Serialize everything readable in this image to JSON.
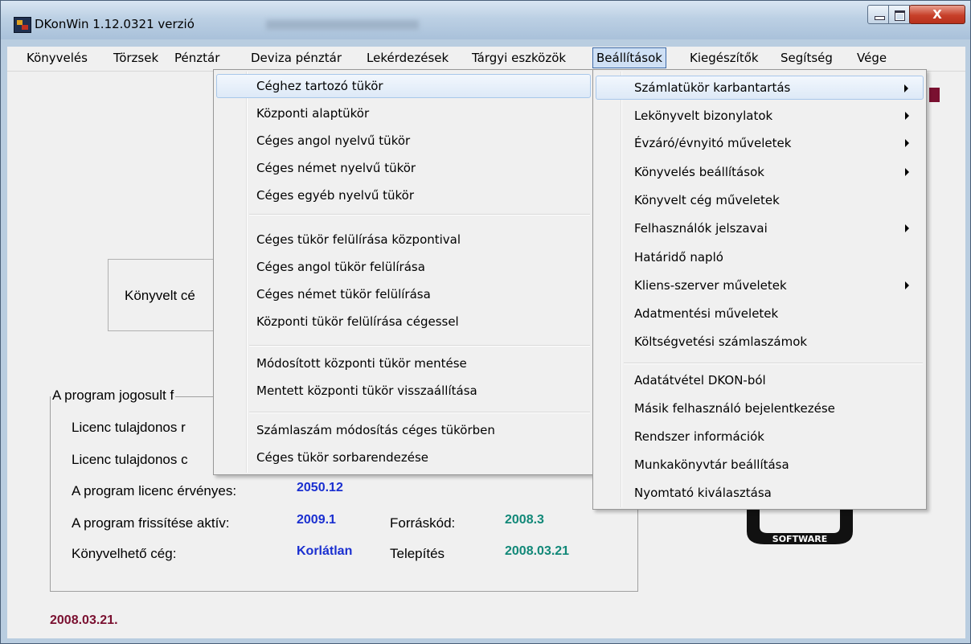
{
  "window": {
    "title": "DKonWin 1.12.0321 verzió",
    "close_glyph": "X"
  },
  "menubar": {
    "items": [
      "Könyvelés",
      "Törzsek",
      "Pénztár",
      "Deviza pénztár",
      "Lekérdezések",
      "Tárgyi eszközök",
      "Beállítások",
      "Kiegészítők",
      "Segítség",
      "Vége"
    ],
    "active": "Beállítások"
  },
  "settings_menu": {
    "items": [
      {
        "label": "Számlatükör karbantartás",
        "submenu": true,
        "highlighted": true
      },
      {
        "label": "Lekönyvelt bizonylatok",
        "submenu": true
      },
      {
        "label": "Évzáró/évnyitó műveletek",
        "submenu": true
      },
      {
        "label": "Könyvelés beállítások",
        "submenu": true
      },
      {
        "label": "Könyvelt cég műveletek",
        "submenu": false
      },
      {
        "label": "Felhasználók jelszavai",
        "submenu": true
      },
      {
        "label": "Határidő napló",
        "submenu": false
      },
      {
        "label": "Kliens-szerver műveletek",
        "submenu": true
      },
      {
        "label": "Adatmentési műveletek",
        "submenu": false
      },
      {
        "label": "Költségvetési számlaszámok",
        "submenu": false
      },
      {
        "label": "Adatátvétel DKON-ból",
        "submenu": false
      },
      {
        "label": "Másik felhasználó bejelentkezése",
        "submenu": false
      },
      {
        "label": "Rendszer információk",
        "submenu": false
      },
      {
        "label": "Munkakönyvtár beállítása",
        "submenu": false
      },
      {
        "label": "Nyomtató kiválasztása",
        "submenu": false
      }
    ]
  },
  "chart_submenu": {
    "items": [
      {
        "label": "Céghez tartozó tükör",
        "highlighted": true
      },
      {
        "label": "Központi alaptükör"
      },
      {
        "label": "Céges angol nyelvű tükör"
      },
      {
        "label": "Céges német nyelvű tükör"
      },
      {
        "label": "Céges egyéb nyelvű tükör"
      },
      {
        "label": "Céges tükör felülírása központival"
      },
      {
        "label": "Céges angol tükör felülírása"
      },
      {
        "label": "Céges német tükör felülírása"
      },
      {
        "label": "Központi tükör felülírása cégessel"
      },
      {
        "label": "Módosított központi tükör mentése"
      },
      {
        "label": "Mentett központi tükör visszaállítása"
      },
      {
        "label": "Számlaszám módosítás céges tükörben"
      },
      {
        "label": "Céges tükör sorbarendezése"
      }
    ]
  },
  "background": {
    "company_box_text": "Könyvelt cé",
    "license_group_title": "A program jogosult f",
    "owner_name_label": "Licenc tulajdonos r",
    "owner_address_label": "Licenc tulajdonos c",
    "license_valid_label": "A program licenc érvényes:",
    "license_valid_value": "2050.12",
    "update_label": "A program frissítése aktív:",
    "update_value": "2009.1",
    "source_label": "Forráskód:",
    "source_value": "2008.3",
    "company_label": "Könyvelhető cég:",
    "company_value": "Korlátlan",
    "install_label": "Telepítés",
    "install_value": "2008.03.21",
    "bottom_date": "2008.03.21.",
    "logo_text": "SOFTWARE"
  }
}
